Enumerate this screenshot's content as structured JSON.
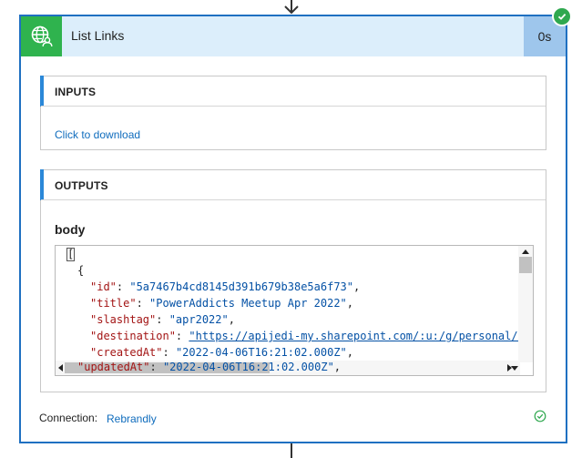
{
  "colors": {
    "accent": "#1f70c1",
    "header_bg": "#dceefb",
    "icon_bg": "#2fb34e",
    "duration_bg": "#9ec6ec",
    "link": "#0f6cbd",
    "success": "#2fa84f"
  },
  "action": {
    "title": "List Links",
    "icon": "globe-person-icon",
    "duration": "0s",
    "status_icon": "check-circle-icon"
  },
  "inputs": {
    "title": "INPUTS",
    "download_label": "Click to download"
  },
  "outputs": {
    "title": "OUTPUTS",
    "body_label": "body",
    "code": {
      "line0": "[",
      "line1": "{",
      "id_key": "\"id\"",
      "id_value": "\"5a7467b4cd8145d391b679b38e5a6f73\"",
      "title_key": "\"title\"",
      "title_value": "\"PowerAddicts Meetup Apr 2022\"",
      "slashtag_key": "\"slashtag\"",
      "slashtag_value": "\"apr2022\"",
      "destination_key": "\"destination\"",
      "destination_value": "\"https://apijedi-my.sharepoint.com/:u:/g/personal/vi",
      "createdAt_key": "\"createdAt\"",
      "createdAt_value": "\"2022-04-06T16:21:02.000Z\"",
      "updatedAt_key": "\"updatedAt\"",
      "updatedAt_value_a": "\"2022-04-06T16",
      "updatedAt_value_b": ":21:02.000Z\""
    }
  },
  "connection": {
    "label": "Connection:",
    "value": "Rebrandly",
    "status_icon": "check-circle-outline-icon"
  }
}
